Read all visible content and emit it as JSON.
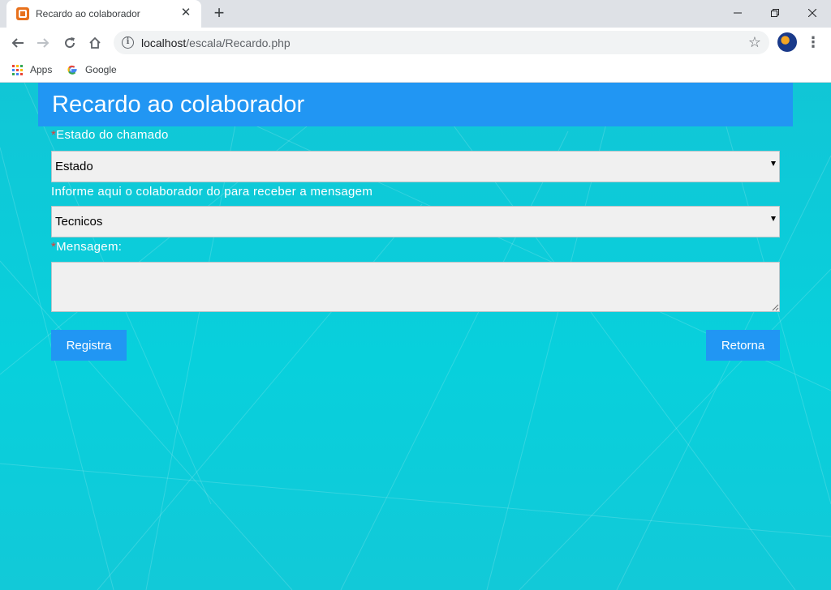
{
  "browser": {
    "tab_title": "Recardo ao colaborador",
    "url_host": "localhost",
    "url_path": "/escala/Recardo.php",
    "bookmarks": [
      {
        "label": "Apps",
        "icon": "apps-grid-icon"
      },
      {
        "label": "Google",
        "icon": "google-icon"
      }
    ]
  },
  "page": {
    "title": "Recardo ao colaborador",
    "fields": {
      "estado": {
        "required_mark": "*",
        "label": "Estado do chamado",
        "selected": "Estado"
      },
      "colaborador": {
        "label": "Informe aqui o colaborador do para receber a mensagem",
        "selected": "Tecnicos"
      },
      "mensagem": {
        "required_mark": "*",
        "label": "Mensagem:",
        "value": ""
      }
    },
    "buttons": {
      "registra": "Registra",
      "retorna": "Retorna"
    }
  },
  "colors": {
    "header": "#2196f3",
    "button": "#2196f3",
    "background": "#08d0dc",
    "required": "#e53935"
  }
}
